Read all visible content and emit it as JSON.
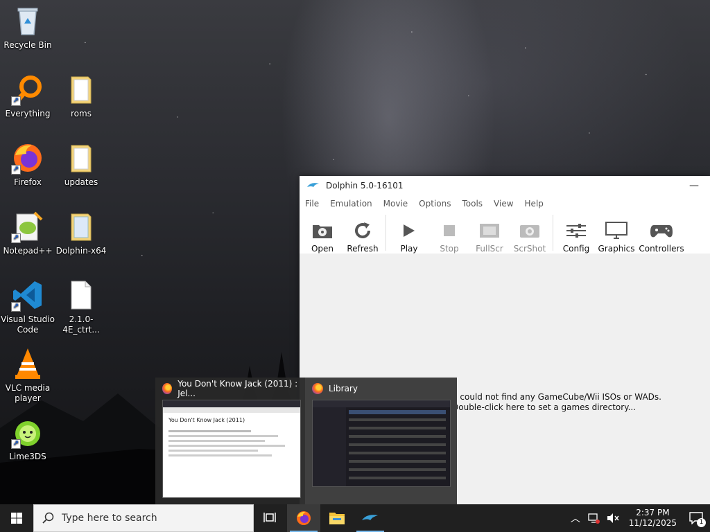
{
  "desktop": {
    "icons": [
      {
        "label": "Recycle Bin"
      },
      {
        "label": "Everything"
      },
      {
        "label": "roms"
      },
      {
        "label": "Firefox"
      },
      {
        "label": "updates"
      },
      {
        "label": "Notepad++"
      },
      {
        "label": "Dolphin-x64"
      },
      {
        "label": "Visual Studio Code"
      },
      {
        "label": "2.1.0-4E_ctrt..."
      },
      {
        "label": "VLC media player"
      },
      {
        "label": "Lime3DS"
      }
    ]
  },
  "dolphin": {
    "title": "Dolphin 5.0-16101",
    "minimize": "—",
    "menu": [
      "File",
      "Emulation",
      "Movie",
      "Options",
      "Tools",
      "View",
      "Help"
    ],
    "toolbar": [
      "Open",
      "Refresh",
      "Play",
      "Stop",
      "FullScr",
      "ScrShot",
      "Config",
      "Graphics",
      "Controllers"
    ],
    "message_line1": "n could not find any GameCube/Wii ISOs or WADs.",
    "message_line2": "Double-click here to set a games directory..."
  },
  "thumbnails": [
    {
      "title": "You Don't Know Jack (2011) : Jel...",
      "page_heading": "You Don't Know Jack (2011)"
    },
    {
      "title": "Library"
    }
  ],
  "taskbar": {
    "search_placeholder": "Type here to search",
    "time": "2:37 PM",
    "date": "11/12/2025",
    "notification_count": "1"
  }
}
